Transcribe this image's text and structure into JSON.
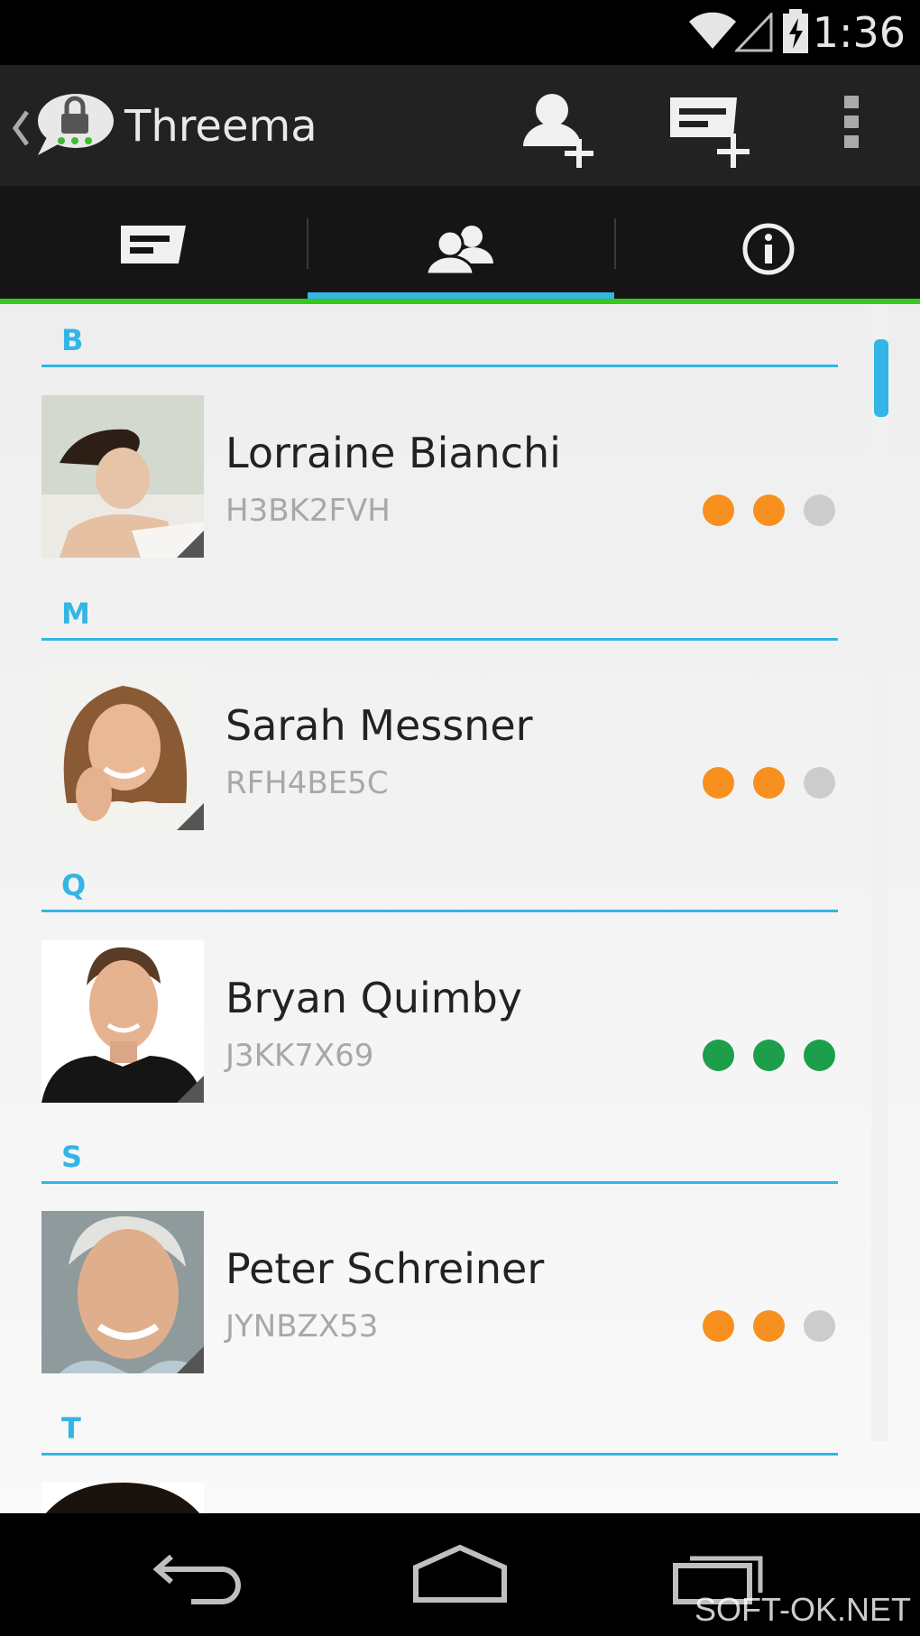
{
  "status_bar": {
    "time": "1:36"
  },
  "app": {
    "title": "Threema"
  },
  "colors": {
    "accent": "#33b5e5",
    "green_bar": "#35c81f",
    "level_orange": "#f7901e",
    "level_green": "#1d9e4a",
    "level_gray": "#cccccc"
  },
  "icons": {
    "up": "chevron-left-icon",
    "logo": "threema-logo-icon",
    "add_contact": "add-contact-icon",
    "new_message": "new-message-icon",
    "overflow": "overflow-menu-icon",
    "tabs": [
      "messages-icon",
      "contacts-icon",
      "info-icon"
    ],
    "nav": [
      "back-icon",
      "home-icon",
      "recents-icon"
    ]
  },
  "tabs": [
    {
      "name": "messages",
      "selected": false
    },
    {
      "name": "contacts",
      "selected": true
    },
    {
      "name": "info",
      "selected": false
    }
  ],
  "sections": [
    {
      "letter": "B",
      "contacts": [
        {
          "name": "Lorraine Bianchi",
          "id": "H3BK2FVH",
          "verification": [
            "orange",
            "orange",
            "gray"
          ]
        }
      ]
    },
    {
      "letter": "M",
      "contacts": [
        {
          "name": "Sarah Messner",
          "id": "RFH4BE5C",
          "verification": [
            "orange",
            "orange",
            "gray"
          ]
        }
      ]
    },
    {
      "letter": "Q",
      "contacts": [
        {
          "name": "Bryan Quimby",
          "id": "J3KK7X69",
          "verification": [
            "green",
            "green",
            "green"
          ]
        }
      ]
    },
    {
      "letter": "S",
      "contacts": [
        {
          "name": "Peter Schreiner",
          "id": "JYNBZX53",
          "verification": [
            "orange",
            "orange",
            "gray"
          ]
        }
      ]
    },
    {
      "letter": "T",
      "contacts": []
    }
  ],
  "watermark": "SOFT-OK.NET"
}
